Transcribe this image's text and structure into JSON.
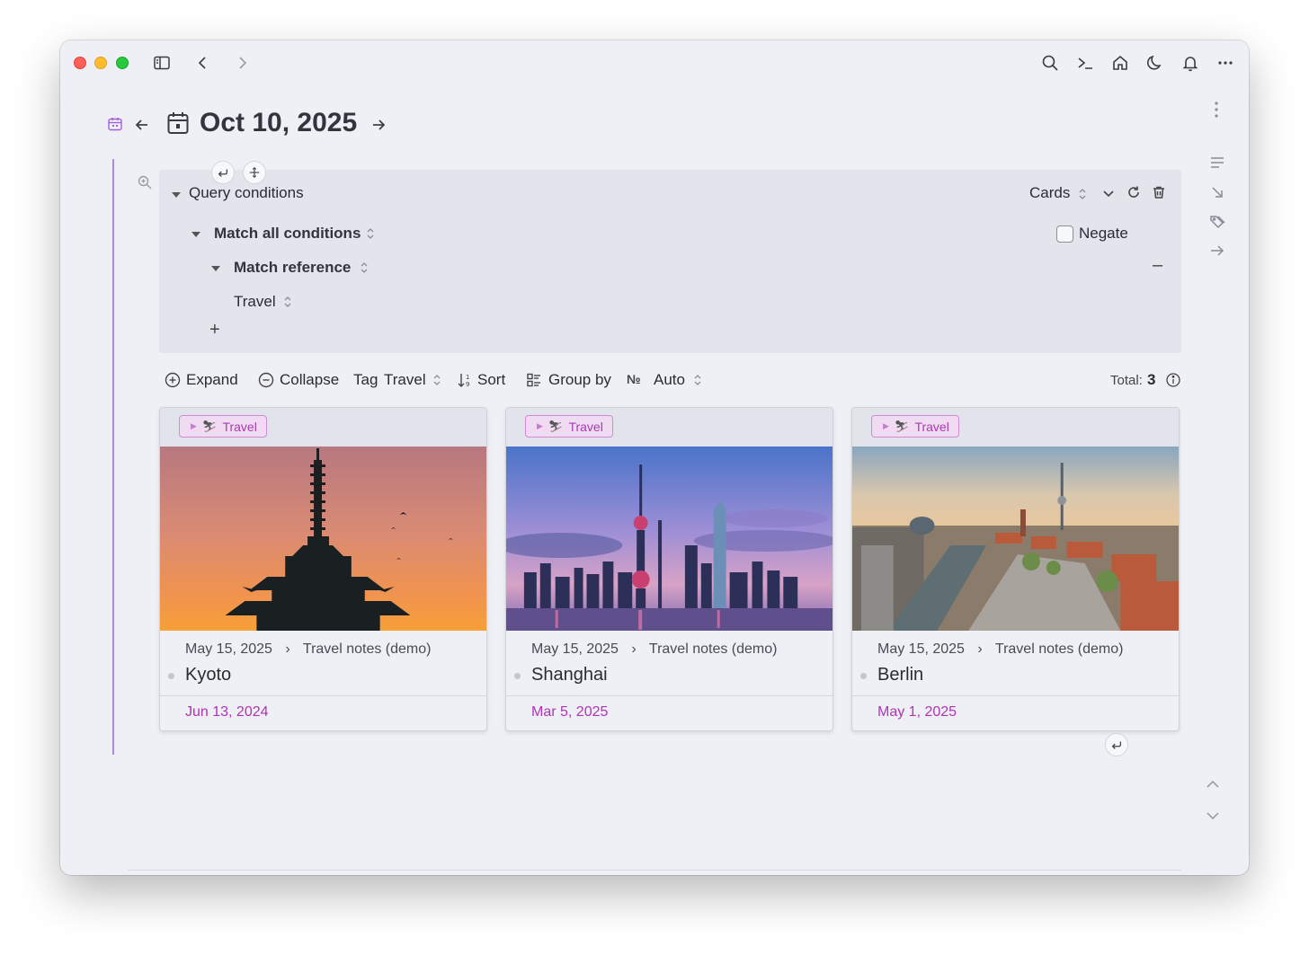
{
  "header": {
    "title": "Oct 10, 2025"
  },
  "query": {
    "label": "Query conditions",
    "view_mode": "Cards",
    "match_all": "Match all conditions",
    "negate_label": "Negate",
    "match_reference": "Match reference",
    "reference_value": "Travel",
    "add_symbol": "+",
    "remove_symbol": "–"
  },
  "toolbar": {
    "expand": "Expand",
    "collapse": "Collapse",
    "tag_prefix": "Tag",
    "tag_value": "Travel",
    "sort": "Sort",
    "group_by": "Group by",
    "number_symbol": "№",
    "auto": "Auto",
    "total_label": "Total:",
    "total_count": "3"
  },
  "cards": [
    {
      "tag": "Travel",
      "date": "May 15, 2025",
      "page": "Travel notes (demo)",
      "title": "Kyoto",
      "footer_date": "Jun 13, 2024"
    },
    {
      "tag": "Travel",
      "date": "May 15, 2025",
      "page": "Travel notes (demo)",
      "title": "Shanghai",
      "footer_date": "Mar 5, 2025"
    },
    {
      "tag": "Travel",
      "date": "May 15, 2025",
      "page": "Travel notes (demo)",
      "title": "Berlin",
      "footer_date": "May 1, 2025"
    }
  ],
  "colors": {
    "accent": "#b032b8",
    "accent_line": "#a78bdc",
    "panel_bg": "#e3e5ec",
    "window_bg": "#eff0f5"
  },
  "icons": [
    "sidebar-toggle-icon",
    "back-icon",
    "forward-icon",
    "search-icon",
    "terminal-icon",
    "home-icon",
    "moon-icon",
    "bell-icon",
    "more-icon",
    "calendar-icon",
    "arrow-left-icon",
    "arrow-right-icon",
    "kebab-icon",
    "outline-icon",
    "collapse-icon",
    "tag-icon",
    "link-icon",
    "return-icon",
    "drag-icon",
    "zoom-icon",
    "caret-down-icon",
    "updown-icon",
    "refresh-icon",
    "trash-icon",
    "plus-circle-icon",
    "minus-circle-icon",
    "sort-icon",
    "group-icon",
    "info-icon",
    "chevron-up-icon",
    "chevron-down-icon"
  ]
}
